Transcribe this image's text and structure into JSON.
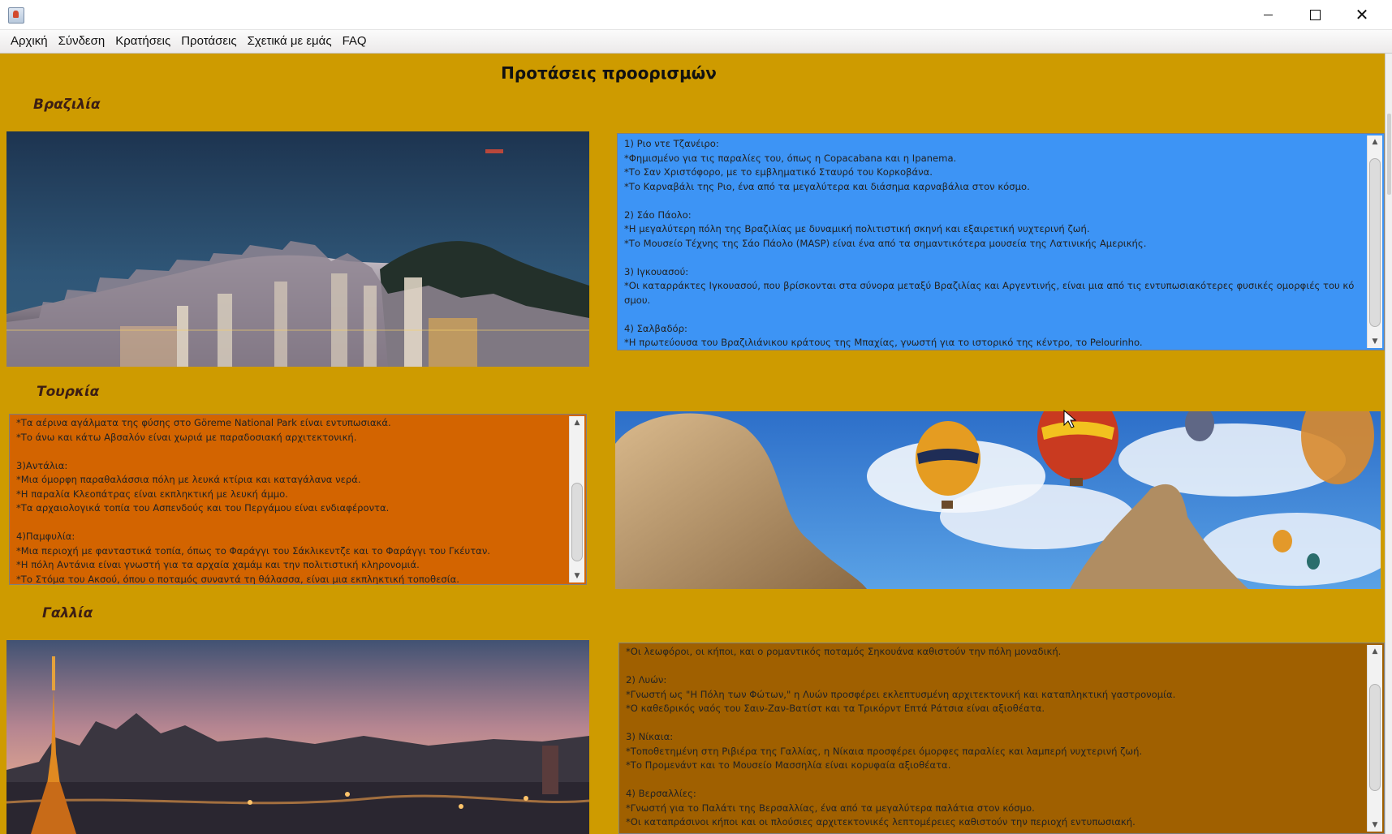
{
  "window": {
    "minimize_icon": "minimize-icon",
    "maximize_icon": "maximize-icon",
    "close_icon": "close-icon",
    "close_glyph": "✕"
  },
  "menu": {
    "items": [
      "Αρχική",
      "Σύνδεση",
      "Κρατήσεις",
      "Προτάσεις",
      "Σχετικά με εμάς",
      "FAQ"
    ]
  },
  "page": {
    "title": "Προτάσεις προορισμών"
  },
  "sections": [
    {
      "country": "Βραζιλία",
      "image": "rio-de-janeiro-night-photo",
      "text": "1) Ριο ντε Τζανέιρο:\n*Φημισμένο για τις παραλίες του, όπως η Copacabana και η Ipanema.\n*Το Σαν Χριστόφορο, με το εμβληματικό Σταυρό του Κορκοβάνα.\n*Το Καρναβάλι της Ριο, ένα από τα μεγαλύτερα και διάσημα καρναβάλια στον κόσμο.\n\n2) Σάο Πάολο:\n*Η μεγαλύτερη πόλη της Βραζιλίας με δυναμική πολιτιστική σκηνή και εξαιρετική νυχτερινή ζωή.\n*Το Μουσείο Τέχνης της Σάο Πάολο (MASP) είναι ένα από τα σημαντικότερα μουσεία της Λατινικής Αμερικής.\n\n3) Ιγκουασού:\n*Οι καταρράκτες Ιγκουασού, που βρίσκονται στα σύνορα μεταξύ Βραζιλίας και Αργεντινής, είναι μια από τις εντυπωσιακότερες φυσικές ομορφιές του κό σμου.\n\n4) Σαλβαδόρ:\n*Η πρωτεύουσα του Βραζιλιάνικου κράτους της Μπαχίας, γνωστή για το ιστορικό της κέντρο, το Pelourinho.\n*Οι παραλίες της, όπως η Porto da Barra, είναι εξαιρετικές για χαλάρωση|"
    },
    {
      "country": "Τουρκία",
      "image": "cappadocia-balloons-photo",
      "text": "*Τα αέρινα αγάλματα της φύσης στο Göreme National Park είναι εντυπωσιακά.\n*Το άνω και κάτω Αβσαλόν είναι χωριά με παραδοσιακή αρχιτεκτονική.\n\n3)Αντάλια:\n*Μια όμορφη παραθαλάσσια πόλη με λευκά κτίρια και καταγάλανα νερά.\n*Η παραλία Κλεοπάτρας είναι εκπληκτική με λευκή άμμο.\n*Τα αρχαιολογικά τοπία του Ασπενδούς και του Περγάμου είναι ενδιαφέροντα.\n\n4)Παμφυλία:\n*Μια περιοχή με φανταστικά τοπία, όπως το Φαράγγι του Σάκλικεντζε και το Φαράγγι του Γκέυταν.\n*Η πόλη Αντάνια είναι γνωστή για τα αρχαία χαμάμ και την πολιτιστική κληρονομιά.\n*Το Στόμα του Ακσού, όπου ο ποταμός συναντά τη θάλασσα, είναι μια εκπληκτική τοποθεσία."
    },
    {
      "country": "Γαλλία",
      "image": "paris-eiffel-tower-photo",
      "text": "*Οι λεωφόροι, οι κήποι, και ο ρομαντικός ποταμός Σηκουάνα καθιστούν την πόλη μοναδική.\n\n2) Λυών:\n*Γνωστή ως \"Η Πόλη των Φώτων,\" η Λυών προσφέρει εκλεπτυσμένη αρχιτεκτονική και καταπληκτική γαστρονομία.\n*Ο καθεδρικός ναός του Σαιν-Ζαν-Βατίστ και τα Τρικόρντ Επτά Ράτσια είναι αξιοθέατα.\n\n3) Νίκαια:\n*Τοποθετημένη στη Ριβιέρα της Γαλλίας, η Νίκαια προσφέρει όμορφες παραλίες και λαμπερή νυχτερινή ζωή.\n*Το Προμενάντ και το Μουσείο Μασσηλία είναι κορυφαία αξιοθέατα.\n\n4) Βερσαλλίες:\n*Γνωστή για το Παλάτι της Βερσαλλίας, ένα από τα μεγαλύτερα παλάτια στον κόσμο.\n*Οι καταπράσινοι κήποι και οι πλούσιες αρχιτεκτονικές λεπτομέρειες καθιστούν την περιοχή εντυπωσιακή."
    }
  ],
  "colors": {
    "background": "#ce9b00",
    "brazil_box": "#3d94f5",
    "turkey_box": "#d36400",
    "france_box": "#a06000"
  }
}
